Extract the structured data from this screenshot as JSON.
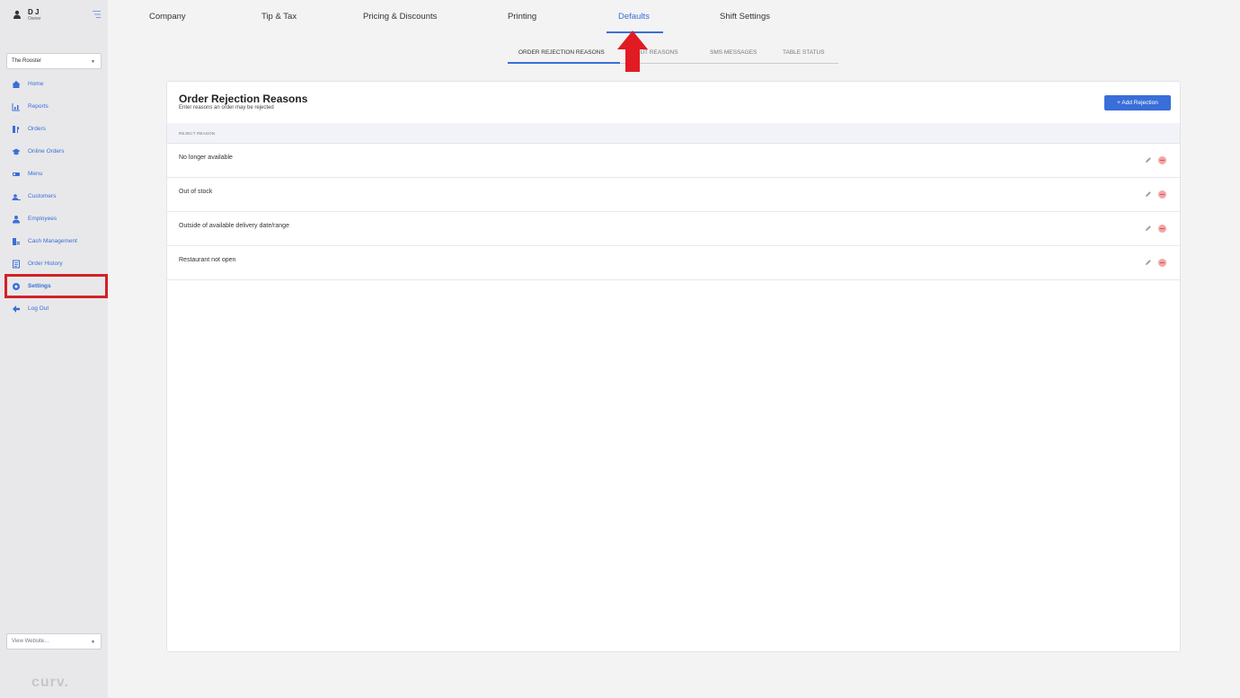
{
  "user": {
    "name": "D J",
    "role": "Owner"
  },
  "location_select": {
    "value": "The Rooster"
  },
  "nav": [
    {
      "label": "Home",
      "icon": "home-icon"
    },
    {
      "label": "Reports",
      "icon": "chart-icon"
    },
    {
      "label": "Orders",
      "icon": "orders-icon"
    },
    {
      "label": "Online Orders",
      "icon": "online-orders-icon"
    },
    {
      "label": "Menu",
      "icon": "menu-icon"
    },
    {
      "label": "Customers",
      "icon": "customers-icon"
    },
    {
      "label": "Employees",
      "icon": "employees-icon"
    },
    {
      "label": "Cash Management",
      "icon": "cash-icon"
    },
    {
      "label": "Order History",
      "icon": "history-icon"
    },
    {
      "label": "Settings",
      "icon": "gear-icon"
    },
    {
      "label": "Log Out",
      "icon": "arrow-left-icon"
    }
  ],
  "website_select": {
    "value": "View Website..."
  },
  "logo": "curv.",
  "top_tabs": [
    "Company",
    "Tip & Tax",
    "Pricing & Discounts",
    "Printing",
    "Defaults",
    "Shift Settings"
  ],
  "active_top_tab": "Defaults",
  "sub_tabs": [
    "ORDER REJECTION REASONS",
    "...OUT REASONS",
    "SMS MESSAGES",
    "TABLE STATUS"
  ],
  "active_sub_tab": "ORDER REJECTION REASONS",
  "card": {
    "title": "Order Rejection Reasons",
    "subtitle": "Enter reasons an order may be rejected",
    "add_button": "+ Add Rejection",
    "column_header": "REJECT REASON",
    "rows": [
      "No longer available",
      "Out of stock",
      "Outside of available delivery date/range",
      "Restaurant not open"
    ]
  },
  "colors": {
    "accent": "#3a6ed8",
    "highlight": "#d42027",
    "sidebar": "#e8e8ea"
  }
}
